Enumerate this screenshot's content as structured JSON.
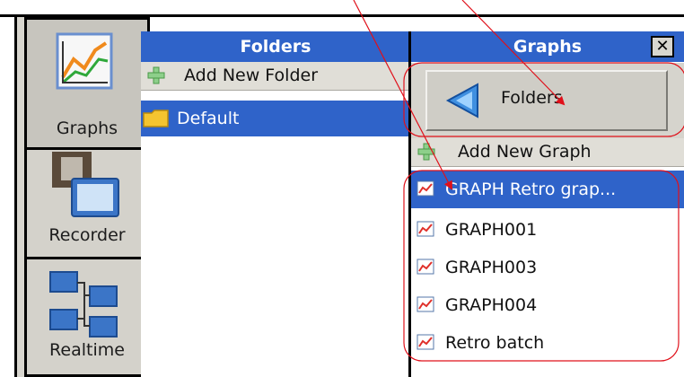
{
  "nav": {
    "items": [
      {
        "label": "Graphs",
        "icon": "graph-chart-icon",
        "active": true
      },
      {
        "label": "Recorder",
        "icon": "recorder-monitor-icon",
        "active": false
      },
      {
        "label": "Realtime",
        "icon": "network-computers-icon",
        "active": false
      }
    ]
  },
  "folders_panel": {
    "header": "Folders",
    "add_label": "Add New Folder",
    "items": [
      {
        "label": "Default",
        "icon": "folder-icon",
        "selected": true
      }
    ]
  },
  "graphs_panel": {
    "header": "Graphs",
    "close_label": "✕",
    "back_label": "Folders",
    "add_label": "Add New Graph",
    "items": [
      {
        "label": "GRAPH Retro grap...",
        "selected": true
      },
      {
        "label": "GRAPH001",
        "selected": false
      },
      {
        "label": "GRAPH003",
        "selected": false
      },
      {
        "label": "GRAPH004",
        "selected": false
      },
      {
        "label": "Retro batch",
        "selected": false
      }
    ]
  },
  "colors": {
    "selection": "#2f63c9",
    "panel": "#d8d6cf",
    "annotation": "#e0101a"
  }
}
